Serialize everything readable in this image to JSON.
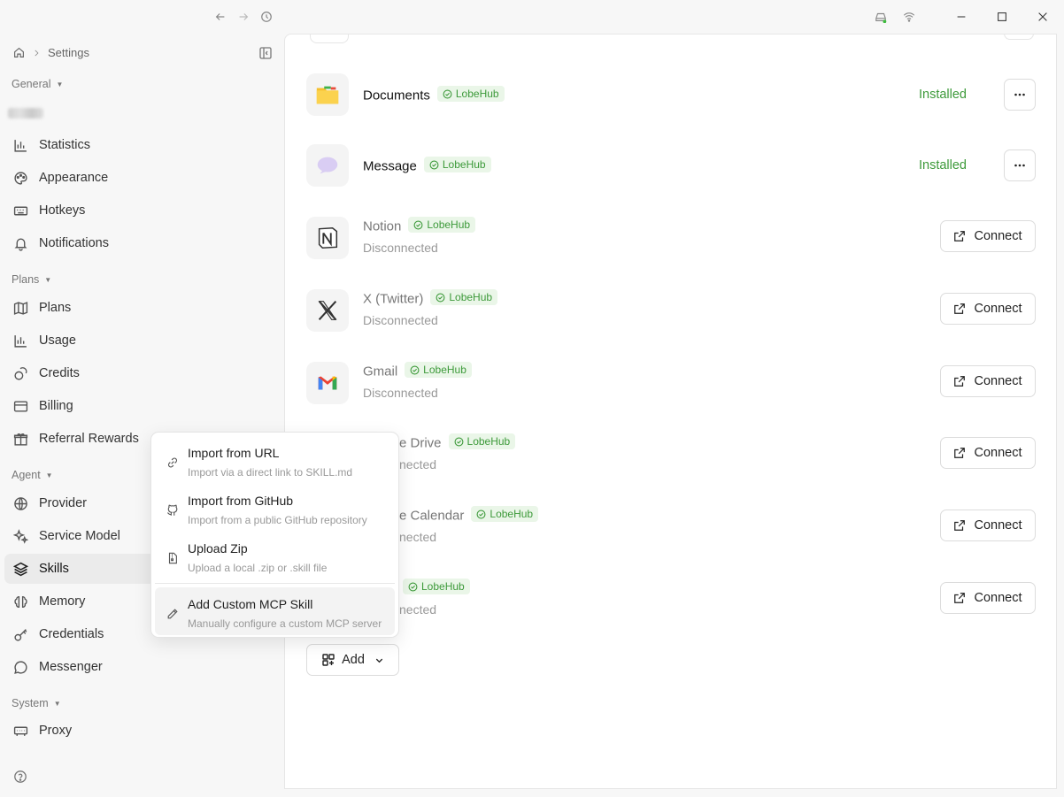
{
  "breadcrumb": {
    "current": "Settings"
  },
  "sidebar": {
    "groups": {
      "general": "General",
      "plans": "Plans",
      "agent": "Agent",
      "system": "System"
    },
    "items": [
      {
        "key": "statistics",
        "label": "Statistics"
      },
      {
        "key": "appearance",
        "label": "Appearance"
      },
      {
        "key": "hotkeys",
        "label": "Hotkeys"
      },
      {
        "key": "notifications",
        "label": "Notifications"
      },
      {
        "key": "plans",
        "label": "Plans"
      },
      {
        "key": "usage",
        "label": "Usage"
      },
      {
        "key": "credits",
        "label": "Credits"
      },
      {
        "key": "billing",
        "label": "Billing"
      },
      {
        "key": "referral",
        "label": "Referral Rewards"
      },
      {
        "key": "provider",
        "label": "Provider"
      },
      {
        "key": "service_model",
        "label": "Service Model"
      },
      {
        "key": "skills",
        "label": "Skills"
      },
      {
        "key": "memory",
        "label": "Memory"
      },
      {
        "key": "credentials",
        "label": "Credentials"
      },
      {
        "key": "messenger",
        "label": "Messenger"
      },
      {
        "key": "proxy",
        "label": "Proxy"
      }
    ]
  },
  "skills": [
    {
      "name": "Documents",
      "badge": "LobeHub",
      "status": "Installed",
      "icon": "folder-icon"
    },
    {
      "name": "Message",
      "badge": "LobeHub",
      "status": "Installed",
      "icon": "message-bubble-icon"
    },
    {
      "name": "Notion",
      "badge": "LobeHub",
      "sub": "Disconnected",
      "action": "Connect",
      "icon": "notion-icon"
    },
    {
      "name": "X (Twitter)",
      "badge": "LobeHub",
      "sub": "Disconnected",
      "action": "Connect",
      "icon": "x-twitter-icon"
    },
    {
      "name": "Gmail",
      "badge": "LobeHub",
      "sub": "Disconnected",
      "action": "Connect",
      "icon": "gmail-icon"
    },
    {
      "name": "e Drive",
      "badge": "LobeHub",
      "sub": "nected",
      "action": "Connect"
    },
    {
      "name": "e Calendar",
      "badge": "LobeHub",
      "sub": "nected",
      "action": "Connect"
    },
    {
      "name": "",
      "badge": "LobeHub",
      "sub": "nected",
      "action": "Connect"
    }
  ],
  "add_button": {
    "label": "Add"
  },
  "dropdown": {
    "items": [
      {
        "title": "Import from URL",
        "desc": "Import via a direct link to SKILL.md",
        "icon": "link-icon"
      },
      {
        "title": "Import from GitHub",
        "desc": "Import from a public GitHub repository",
        "icon": "github-icon"
      },
      {
        "title": "Upload Zip",
        "desc": "Upload a local .zip or .skill file",
        "icon": "zip-file-icon"
      },
      {
        "title": "Add Custom MCP Skill",
        "desc": "Manually configure a custom MCP server",
        "icon": "pencil-icon"
      }
    ]
  },
  "colors": {
    "accent_green": "#3d9a3a",
    "badge_bg": "#eaf6e8",
    "active_bg": "#ebebeb"
  }
}
